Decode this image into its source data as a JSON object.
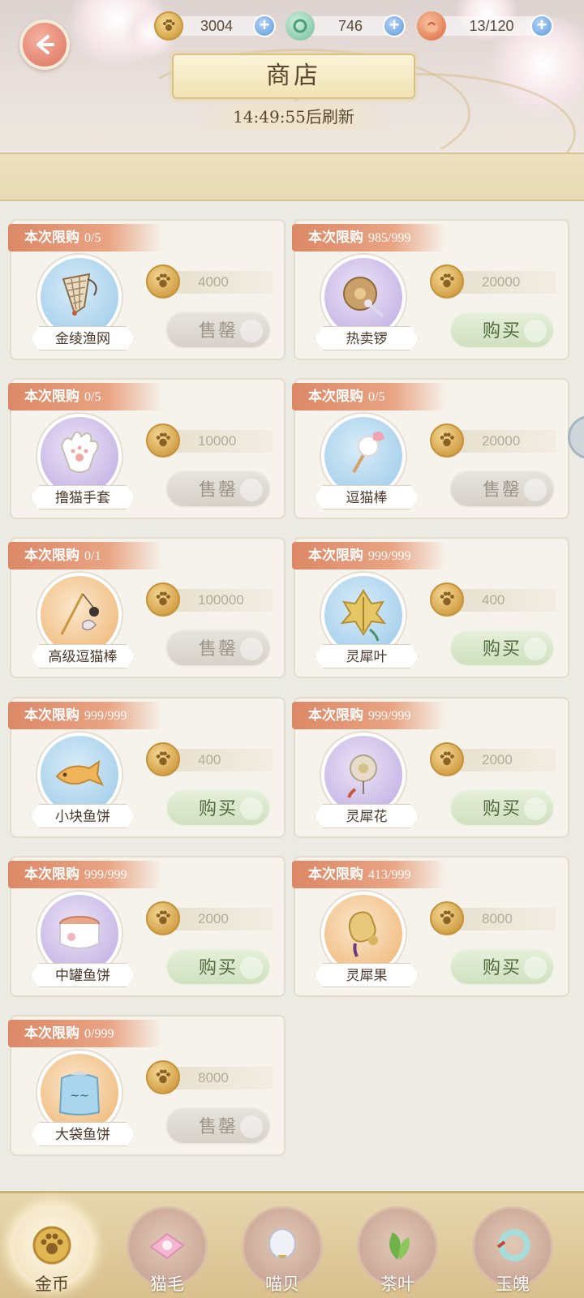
{
  "header": {
    "title": "商店",
    "refresh_text": "14:49:55后刷新",
    "currencies": [
      {
        "icon": "coin-icon",
        "value": "3004"
      },
      {
        "icon": "jade-icon",
        "value": "746"
      },
      {
        "icon": "bun-icon",
        "value": "13/120"
      }
    ]
  },
  "items": [
    {
      "limit_label": "本次限购",
      "limit": "0/5",
      "name": "金绫渔网",
      "price": "4000",
      "button": "售罄",
      "state": "sold",
      "bg": "blue",
      "icon": "fishing-net-icon"
    },
    {
      "limit_label": "本次限购",
      "limit": "985/999",
      "name": "热卖锣",
      "price": "20000",
      "button": "购买",
      "state": "buy",
      "bg": "purple",
      "icon": "gong-icon"
    },
    {
      "limit_label": "本次限购",
      "limit": "0/5",
      "name": "撸猫手套",
      "price": "10000",
      "button": "售罄",
      "state": "sold",
      "bg": "purple",
      "icon": "glove-icon"
    },
    {
      "limit_label": "本次限购",
      "limit": "0/5",
      "name": "逗猫棒",
      "price": "20000",
      "button": "售罄",
      "state": "sold",
      "bg": "blue",
      "icon": "cat-wand-icon"
    },
    {
      "limit_label": "本次限购",
      "limit": "0/1",
      "name": "高级逗猫棒",
      "price": "100000",
      "button": "售罄",
      "state": "sold",
      "bg": "orange",
      "icon": "premium-cat-wand-icon"
    },
    {
      "limit_label": "本次限购",
      "limit": "999/999",
      "name": "灵犀叶",
      "price": "400",
      "button": "购买",
      "state": "buy",
      "bg": "blue",
      "icon": "leaf-icon"
    },
    {
      "limit_label": "本次限购",
      "limit": "999/999",
      "name": "小块鱼饼",
      "price": "400",
      "button": "购买",
      "state": "buy",
      "bg": "blue",
      "icon": "fish-cake-icon"
    },
    {
      "limit_label": "本次限购",
      "limit": "999/999",
      "name": "灵犀花",
      "price": "2000",
      "button": "购买",
      "state": "buy",
      "bg": "purple",
      "icon": "flower-icon"
    },
    {
      "limit_label": "本次限购",
      "limit": "999/999",
      "name": "中罐鱼饼",
      "price": "2000",
      "button": "购买",
      "state": "buy",
      "bg": "purple",
      "icon": "fish-can-icon"
    },
    {
      "limit_label": "本次限购",
      "limit": "413/999",
      "name": "灵犀果",
      "price": "8000",
      "button": "购买",
      "state": "buy",
      "bg": "orange",
      "icon": "fruit-icon"
    },
    {
      "limit_label": "本次限购",
      "limit": "0/999",
      "name": "大袋鱼饼",
      "price": "8000",
      "button": "售罄",
      "state": "sold",
      "bg": "orange",
      "icon": "fish-bag-icon"
    }
  ],
  "tabs": [
    {
      "label": "金币",
      "icon": "coin-icon",
      "active": true
    },
    {
      "label": "猫毛",
      "icon": "cat-fur-icon",
      "active": false
    },
    {
      "label": "喵贝",
      "icon": "shell-icon",
      "active": false
    },
    {
      "label": "茶叶",
      "icon": "tea-leaf-icon",
      "active": false
    },
    {
      "label": "玉魄",
      "icon": "jade-ring-icon",
      "active": false
    }
  ],
  "colors": {
    "accent_orange": "#e48672",
    "limit_tag": "#dc8866",
    "buy_button": "#cfe0bf",
    "sold_button": "#d6d2ca"
  }
}
